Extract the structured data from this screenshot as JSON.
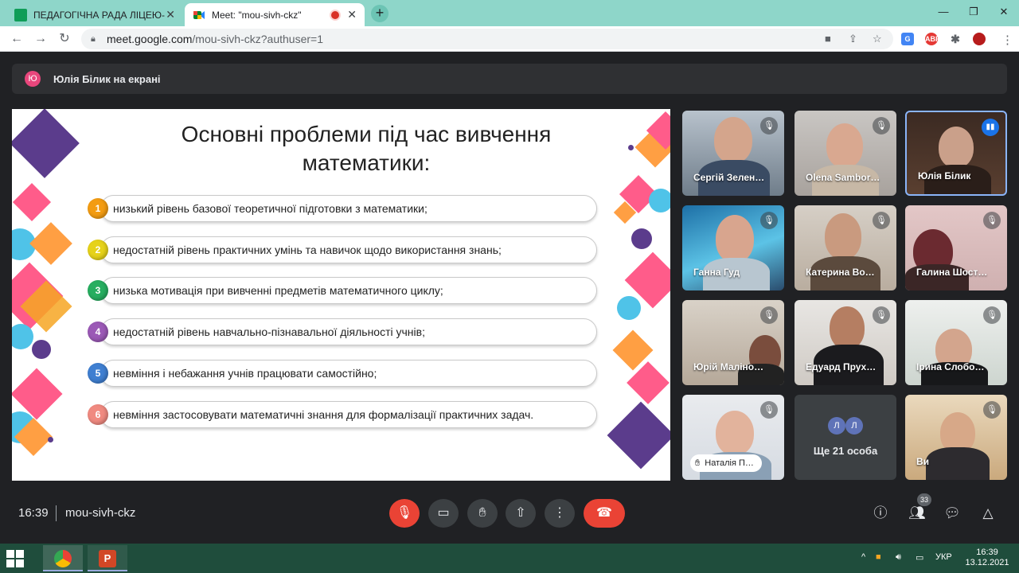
{
  "browser": {
    "tabs": [
      {
        "title": "ПЕДАГОГІЧНА РАДА ЛІЦЕЮ-ІНТ",
        "icon": "google-classroom-icon",
        "active": false
      },
      {
        "title": "Meet: \"mou-sivh-ckz\"",
        "icon": "google-meet-icon",
        "active": true
      }
    ],
    "url_host": "meet.google.com",
    "url_path": "/mou-sivh-ckz?authuser=1"
  },
  "meet": {
    "presenting_avatar": "Ю",
    "presenting_text": "Юлія Білик на екрані",
    "slide": {
      "title": "Основні проблеми під час вивчення математики:",
      "items": [
        {
          "num": "1",
          "text": "низький рівень базової теоретичної підготовки з математики;",
          "color": "#f39c12"
        },
        {
          "num": "2",
          "text": "недостатній рівень практичних умінь та навичок щодо використання знань;",
          "color": "#e6d21a"
        },
        {
          "num": "3",
          "text": "низька мотивація при вивченні предметів математичного циклу;",
          "color": "#27ae60"
        },
        {
          "num": "4",
          "text": "недостатній рівень навчально-пізнавальної діяльності учнів;",
          "color": "#9b59b6"
        },
        {
          "num": "5",
          "text": "невміння і небажання учнів працювати самостійно;",
          "color": "#3f7fd1"
        },
        {
          "num": "6",
          "text": "невміння застосовувати математичні знання для формалізації практичних задач.",
          "color": "#f08a80"
        }
      ]
    },
    "participants": [
      {
        "name": "Сергій Зелен…",
        "muted": true
      },
      {
        "name": "Olena Sambor…",
        "muted": true
      },
      {
        "name": "Юлія Білик",
        "muted": false,
        "speaking": true
      },
      {
        "name": "Ганна Гуд",
        "muted": true
      },
      {
        "name": "Катерина Во…",
        "muted": true
      },
      {
        "name": "Галина Шост…",
        "muted": true
      },
      {
        "name": "Юрій Маліно…",
        "muted": true
      },
      {
        "name": "Едуард Прух…",
        "muted": true
      },
      {
        "name": "Ірина Слобо…",
        "muted": true
      },
      {
        "name": "Наталія П…",
        "muted": true
      },
      {
        "name": "Ви",
        "muted": true
      }
    ],
    "more": {
      "avatars": [
        "Л",
        "Л"
      ],
      "label": "Ще 21 особа"
    },
    "clock": "16:39",
    "meeting_code": "mou-sivh-ckz",
    "people_count": "33"
  },
  "taskbar": {
    "lang": "УКР",
    "time": "16:39",
    "date": "13.12.2021"
  }
}
